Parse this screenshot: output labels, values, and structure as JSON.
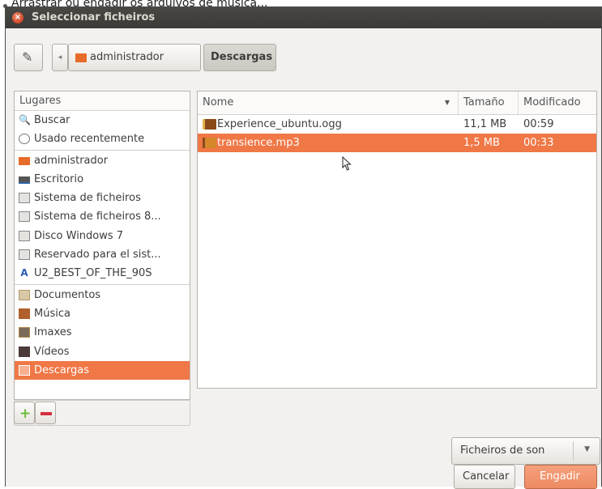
{
  "page_caption": "Arrastrar ou engadir os arquivos de música...",
  "dialog": {
    "title": "Seleccionar ficheiros",
    "close_icon": "close-icon"
  },
  "pathbar": {
    "crumbs": [
      "administrador",
      "Descargas"
    ],
    "active_crumb": "Descargas"
  },
  "places": {
    "header": "Lugares",
    "items": [
      {
        "label": "Buscar",
        "icon": "search-icon"
      },
      {
        "label": "Usado recentemente",
        "icon": "clock-icon"
      },
      {
        "label": "administrador",
        "icon": "home-folder-icon"
      },
      {
        "label": "Escritorio",
        "icon": "desktop-icon"
      },
      {
        "label": "Sistema de ficheiros",
        "icon": "drive-icon"
      },
      {
        "label": "Sistema de ficheiros 8...",
        "icon": "drive-icon"
      },
      {
        "label": "Disco Windows 7",
        "icon": "drive-icon"
      },
      {
        "label": "Reservado para el sist...",
        "icon": "drive-icon"
      },
      {
        "label": "U2_BEST_OF_THE_90S",
        "icon": "cd-icon"
      },
      {
        "label": "Documentos",
        "icon": "documents-folder-icon"
      },
      {
        "label": "Música",
        "icon": "music-folder-icon"
      },
      {
        "label": "Imaxes",
        "icon": "pictures-folder-icon"
      },
      {
        "label": "Vídeos",
        "icon": "videos-folder-icon"
      },
      {
        "label": "Descargas",
        "icon": "downloads-folder-icon",
        "selected": true
      }
    ]
  },
  "files": {
    "columns": {
      "name": "Nome",
      "size": "Tamaño",
      "modified": "Modificado"
    },
    "rows": [
      {
        "name": "Experience_ubuntu.ogg",
        "size": "11,1 MB",
        "modified": "00:59",
        "icon": "audio-file-icon"
      },
      {
        "name": "transience.mp3",
        "size": "1,5 MB",
        "modified": "00:33",
        "icon": "audio-file-icon",
        "selected": true
      }
    ]
  },
  "filter": {
    "selected": "Ficheiros de son"
  },
  "buttons": {
    "cancel": "Cancelar",
    "ok": "Engadir"
  },
  "colors": {
    "accent": "#f07746",
    "titlebar": "#3c3b37",
    "close": "#e05a33"
  }
}
